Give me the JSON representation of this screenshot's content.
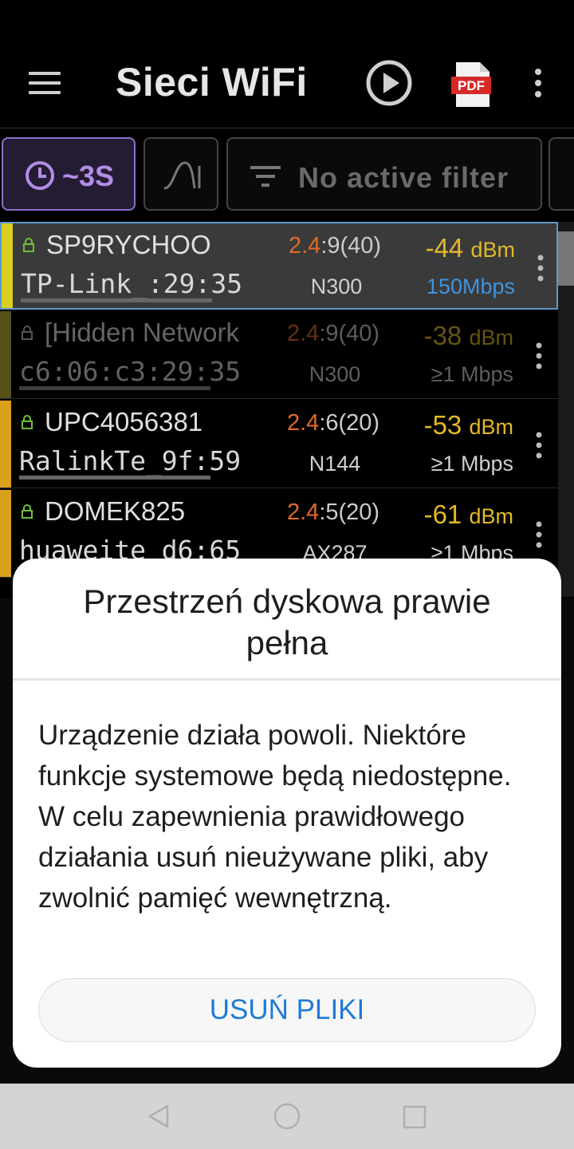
{
  "appbar": {
    "title": "Sieci WiFi",
    "pdf_label": "PDF",
    "icons": [
      "menu-icon",
      "play-icon",
      "pdf-icon",
      "more-vert-icon"
    ]
  },
  "filters": {
    "timer_label": "~3S",
    "filter_label": "No active filter"
  },
  "networks": [
    {
      "ssid": "SP9RYCHOO",
      "vendor": "TP-Link_:29:35",
      "band": "2.4",
      "channel": ":9",
      "width": "(40)",
      "standard": "N300",
      "signal": "-44",
      "unit": "dBm",
      "speed": "150Mbps"
    },
    {
      "ssid": "[Hidden Network",
      "vendor": "c6:06:c3:29:35",
      "band": "2.4",
      "channel": ":9",
      "width": "(40)",
      "standard": "N300",
      "signal": "-38",
      "unit": "dBm",
      "speed": "≥1 Mbps"
    },
    {
      "ssid": "UPC4056381",
      "vendor": "RalinkTe_9f:59",
      "band": "2.4",
      "channel": ":6",
      "width": "(20)",
      "standard": "N144",
      "signal": "-53",
      "unit": "dBm",
      "speed": "≥1 Mbps"
    },
    {
      "ssid": "DOMEK825",
      "vendor": "huaweite_d6:65",
      "band": "2.4",
      "channel": ":5",
      "width": "(20)",
      "standard": "AX287",
      "signal": "-61",
      "unit": "dBm",
      "speed": "≥1 Mbps"
    }
  ],
  "dialog": {
    "title": "Przestrzeń dyskowa prawie pełna",
    "body": "Urządzenie działa powoli. Niektóre funkcje systemowe będą niedostępne. W celu zapewnienia prawidłowego działania usuń nieużywane pliki, aby zwolnić pamięć wewnętrzną.",
    "button": "USUŃ PLIKI"
  },
  "colors": {
    "accent_purple": "#b28de6",
    "band_orange": "#e06a2a",
    "signal_yellow": "#e2b82a",
    "speed_blue": "#3f93e0",
    "button_blue": "#1f7ad6"
  }
}
